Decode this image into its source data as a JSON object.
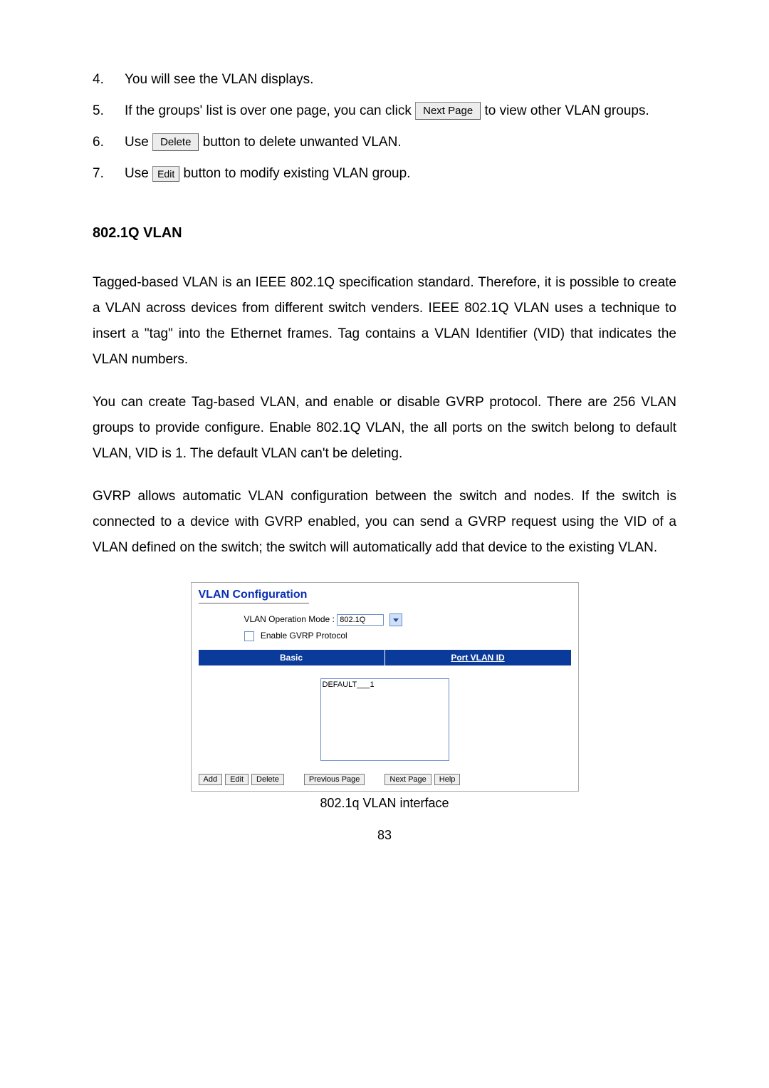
{
  "steps": {
    "s4": {
      "num": "4.",
      "text": "You will see the VLAN displays."
    },
    "s5": {
      "num": "5.",
      "pre": "If the groups' list is over one page, you can click ",
      "btn": "Next Page",
      "post": " to view other VLAN groups."
    },
    "s6": {
      "num": "6.",
      "pre": "Use ",
      "btn": "Delete",
      "post": " button to delete unwanted VLAN."
    },
    "s7": {
      "num": "7.",
      "pre": "Use ",
      "btn": "Edit",
      "post": " button to modify existing VLAN group."
    }
  },
  "section_heading": "802.1Q VLAN",
  "para1": "Tagged-based VLAN is an IEEE 802.1Q specification standard. Therefore, it is possible to create a VLAN across devices from different switch venders. IEEE 802.1Q VLAN uses a technique to insert a \"tag\" into the Ethernet frames. Tag contains a VLAN Identifier (VID) that indicates the VLAN numbers.",
  "para2": "You can create Tag-based VLAN, and enable or disable GVRP protocol. There are 256 VLAN groups to provide configure. Enable 802.1Q VLAN, the all ports on the switch belong to default VLAN, VID is 1. The default VLAN can't be deleting.",
  "para3": "GVRP allows automatic VLAN configuration between the switch and nodes. If the switch is connected to a device with GVRP enabled, you can send a GVRP request using the VID of a VLAN defined on the switch; the switch will automatically add that device to the existing VLAN.",
  "shot": {
    "title": "VLAN Configuration",
    "opmode_label": "VLAN Operation Mode : ",
    "opmode_value": "802.1Q",
    "gvrp_label": "Enable GVRP Protocol",
    "tab_basic": "Basic",
    "tab_pvid": "Port VLAN ID",
    "list_item": "DEFAULT___1",
    "btn_add": "Add",
    "btn_edit": "Edit",
    "btn_delete": "Delete",
    "btn_prev": "Previous Page",
    "btn_next": "Next Page",
    "btn_help": "Help"
  },
  "caption": "802.1q VLAN interface",
  "page_number": "83"
}
